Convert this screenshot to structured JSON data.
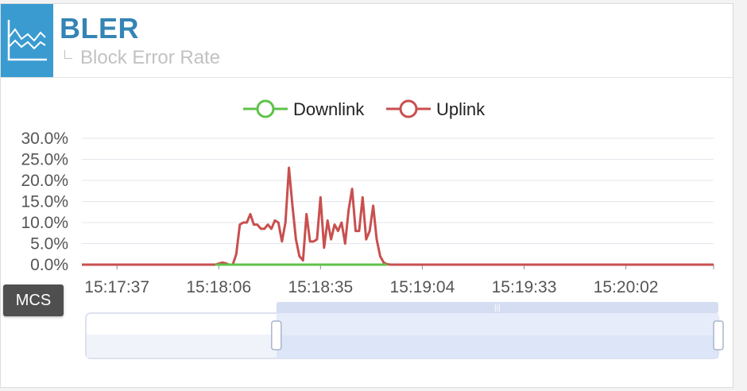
{
  "header": {
    "title": "BLER",
    "subtitle": "Block Error Rate",
    "icon": "line-chart-icon"
  },
  "tag": {
    "label": "MCS"
  },
  "colors": {
    "downlink": "#5fc24a",
    "uplink": "#c94f4f",
    "grid": "#e4e6ee",
    "accent": "#3a9bd1"
  },
  "chart_data": {
    "type": "line",
    "xlabel": "",
    "ylabel": "",
    "y_ticks": [
      "30.0%",
      "25.0%",
      "20.0%",
      "15.0%",
      "10.0%",
      "5.0%",
      "0.0%"
    ],
    "ylim": [
      0,
      30
    ],
    "x_ticks": [
      "15:17:37",
      "15:18:06",
      "15:18:35",
      "15:19:04",
      "15:19:33",
      "15:20:02"
    ],
    "xlim_seconds_after_first_tick": [
      -10,
      170
    ],
    "grid": true,
    "legend_position": "top-center",
    "x": [
      -10,
      0,
      10,
      20,
      25,
      28,
      30,
      31,
      32,
      33,
      34,
      35,
      36,
      37,
      38,
      39,
      40,
      41,
      42,
      43,
      44,
      45,
      46,
      47,
      48,
      49,
      50,
      51,
      52,
      53,
      54,
      55,
      56,
      57,
      58,
      59,
      60,
      61,
      62,
      63,
      64,
      65,
      66,
      67,
      68,
      69,
      70,
      71,
      72,
      73,
      74,
      75,
      76,
      77,
      78,
      79,
      80,
      81,
      82,
      83,
      84,
      85,
      86,
      87,
      88,
      89,
      90,
      100,
      120,
      140,
      170
    ],
    "series": [
      {
        "name": "Downlink",
        "values": [
          0,
          0,
          0,
          0,
          0,
          0,
          0,
          0,
          0,
          0,
          0,
          0,
          0,
          0,
          0,
          0,
          0,
          0,
          0,
          0,
          0,
          0,
          0,
          0,
          0,
          0,
          0,
          0,
          0,
          0,
          0,
          0,
          0,
          0,
          0,
          0,
          0,
          0,
          0,
          0,
          0,
          0,
          0,
          0,
          0,
          0,
          0,
          0,
          0,
          0,
          0,
          0,
          0,
          0,
          0,
          0,
          0,
          0,
          0,
          0,
          0,
          0,
          0,
          0,
          0,
          0,
          0,
          0,
          0,
          0,
          0
        ]
      },
      {
        "name": "Uplink",
        "values": [
          0,
          0,
          0,
          0,
          0,
          0,
          0.5,
          0.3,
          0,
          0,
          2.5,
          9.5,
          10,
          10,
          12,
          9.5,
          9.5,
          8.5,
          8.5,
          9.5,
          8.5,
          10.5,
          10,
          5.5,
          10,
          23,
          14,
          6,
          2,
          1,
          12,
          5.5,
          5.5,
          6,
          16,
          4,
          10.5,
          6,
          9.5,
          8,
          10,
          5,
          13,
          18,
          8,
          8,
          16,
          6,
          8,
          14,
          6,
          2,
          0.5,
          0.1,
          0,
          0,
          0,
          0,
          0,
          0,
          0,
          0,
          0,
          0,
          0,
          0,
          0,
          0,
          0,
          0,
          0
        ]
      }
    ],
    "zoom_range_fraction": [
      0.3,
      1.0
    ]
  }
}
